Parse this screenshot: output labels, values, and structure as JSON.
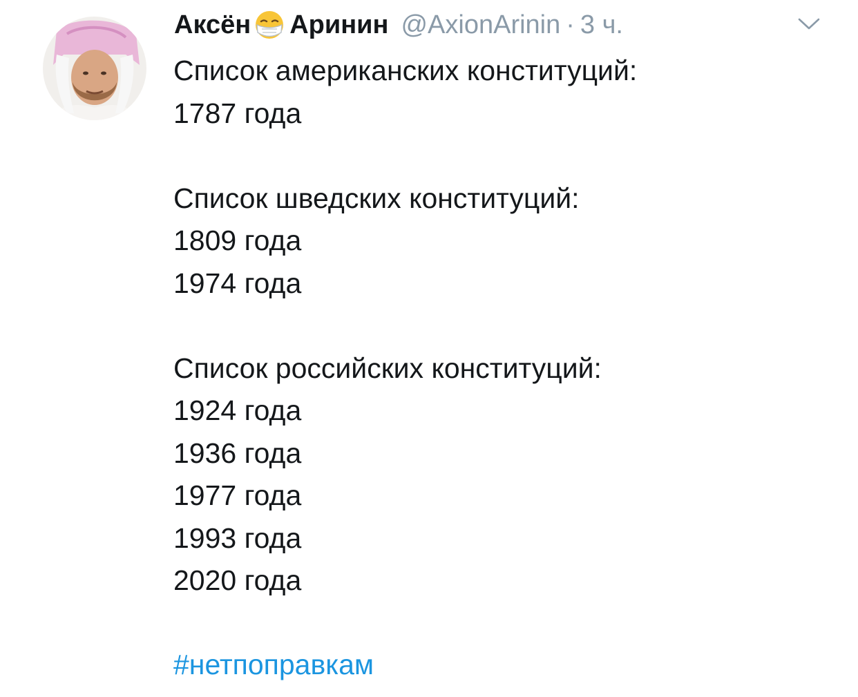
{
  "tweet": {
    "author_name_first": "Аксён",
    "author_name_last": "Аринин",
    "name_emoji_icon": "face-with-medical-mask-icon",
    "handle": "@AxionArinin",
    "separator": "·",
    "time": "3 ч.",
    "caret_icon": "chevron-down-icon",
    "avatar_icon": "avatar-photo",
    "sections": [
      {
        "heading": "Список американских конституций:",
        "years": [
          "1787 года"
        ]
      },
      {
        "heading": "Список шведских конституций:",
        "years": [
          "1809 года",
          "1974 года"
        ]
      },
      {
        "heading": "Список российских конституций:",
        "years": [
          "1924 года",
          "1936 года",
          "1977 года",
          "1993 года",
          "2020 года"
        ]
      }
    ],
    "hashtag": "#нетпоправкам"
  },
  "colors": {
    "text": "#14171a",
    "muted": "#8a9aa8",
    "link": "#1b95e0",
    "background": "#ffffff"
  }
}
